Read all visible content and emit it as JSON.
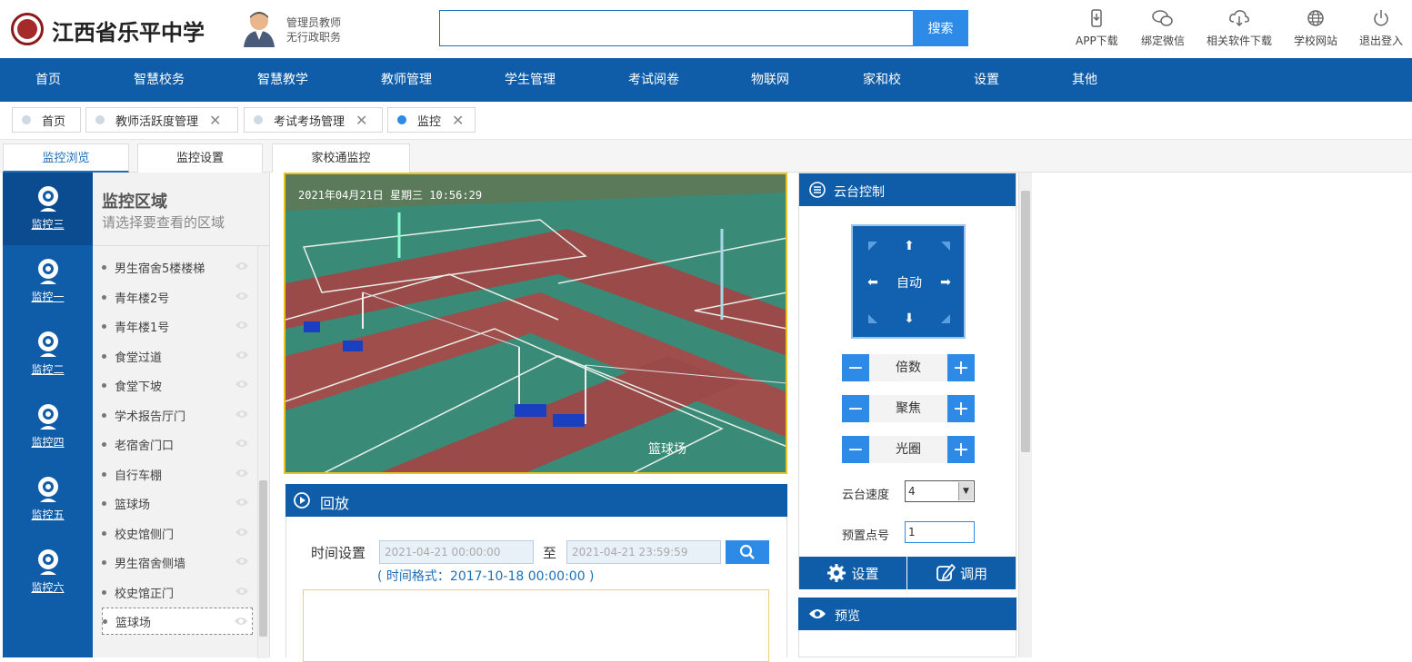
{
  "header": {
    "school_name": "江西省乐平中学",
    "user_role": "管理员教师",
    "user_post": "无行政职务",
    "search_button": "搜索",
    "tools": [
      {
        "label": "APP下载",
        "icon": "phone-download-icon"
      },
      {
        "label": "绑定微信",
        "icon": "wechat-icon"
      },
      {
        "label": "相关软件下载",
        "icon": "cloud-download-icon"
      },
      {
        "label": "学校网站",
        "icon": "globe-icon"
      },
      {
        "label": "退出登入",
        "icon": "power-icon"
      }
    ]
  },
  "nav": [
    "首页",
    "智慧校务",
    "智慧教学",
    "教师管理",
    "学生管理",
    "考试阅卷",
    "物联网",
    "家和校",
    "设置",
    "其他"
  ],
  "tabs": [
    {
      "label": "首页",
      "closable": false,
      "active": false
    },
    {
      "label": "教师活跃度管理",
      "closable": true,
      "active": false
    },
    {
      "label": "考试考场管理",
      "closable": true,
      "active": false
    },
    {
      "label": "监控",
      "closable": true,
      "active": true
    }
  ],
  "subtabs": [
    "监控浏览",
    "监控设置",
    "家校通监控"
  ],
  "cameras": [
    "监控三",
    "监控一",
    "监控二",
    "监控四",
    "监控五",
    "监控六"
  ],
  "area": {
    "title": "监控区域",
    "subtitle": "请选择要查看的区域",
    "items": [
      "男生宿舍5楼楼梯",
      "青年楼2号",
      "青年楼1号",
      "食堂过道",
      "食堂下坡",
      "学术报告厅门",
      "老宿舍门口",
      "自行车棚",
      "篮球场",
      "校史馆侧门",
      "男生宿舍侧墙",
      "校史馆正门",
      "篮球场"
    ]
  },
  "video": {
    "timestamp": "2021年04月21日 星期三 10:56:29",
    "label": "篮球场"
  },
  "playback": {
    "title": "回放",
    "time_label": "时间设置",
    "start_placeholder": "2021-04-21 00:00:00",
    "to": "至",
    "end_placeholder": "2021-04-21 23:59:59",
    "hint": "( 时间格式：2017-10-18 00:00:00 )"
  },
  "ptz": {
    "title": "云台控制",
    "auto": "自动",
    "zoom": "倍数",
    "focus": "聚焦",
    "iris": "光圈",
    "speed_label": "云台速度",
    "speed_value": "4",
    "preset_label": "预置点号",
    "preset_value": "1",
    "settings": "设置",
    "call": "调用"
  },
  "preview": {
    "title": "预览"
  },
  "colors": {
    "primary": "#0f5ca8",
    "accent": "#2d8ae6",
    "video_border": "#e8c31b"
  }
}
